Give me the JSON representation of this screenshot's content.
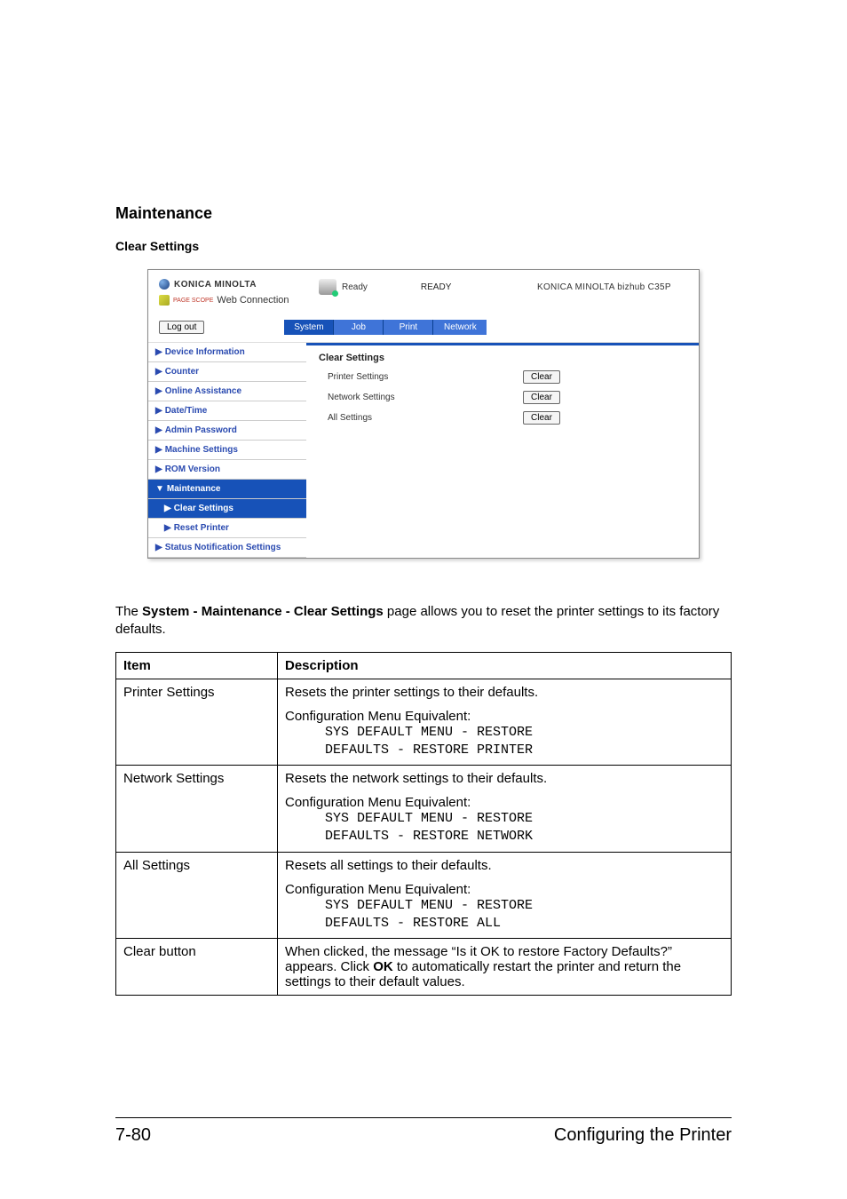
{
  "headings": {
    "main": "Maintenance",
    "sub": "Clear Settings"
  },
  "screenshot": {
    "brand": "KONICA MINOLTA",
    "connection": "Web Connection",
    "pagescope": "PAGE\nSCOPE",
    "status_label": "Ready",
    "ready_big": "READY",
    "model": "KONICA MINOLTA bizhub C35P",
    "logout": "Log out",
    "tabs": {
      "system": "System",
      "job": "Job",
      "print": "Print",
      "network": "Network"
    },
    "sidebar": {
      "device_info": "Device Information",
      "counter": "Counter",
      "online_assist": "Online Assistance",
      "date_time": "Date/Time",
      "admin_pw": "Admin Password",
      "machine": "Machine Settings",
      "rom": "ROM Version",
      "maintenance": "Maintenance",
      "clear_settings": "Clear Settings",
      "reset_printer": "Reset Printer",
      "status_notif": "Status Notification Settings"
    },
    "content": {
      "title": "Clear Settings",
      "rows": [
        {
          "label": "Printer Settings",
          "btn": "Clear"
        },
        {
          "label": "Network Settings",
          "btn": "Clear"
        },
        {
          "label": "All Settings",
          "btn": "Clear"
        }
      ]
    }
  },
  "paragraph": {
    "pre": "The ",
    "bold": "System - Maintenance - Clear Settings",
    "post": " page allows you to reset the printer settings to its factory defaults."
  },
  "table": {
    "head_item": "Item",
    "head_desc": "Description",
    "rows": [
      {
        "item": "Printer Settings",
        "desc": "Resets the printer settings to their defaults.",
        "cme": "Configuration Menu Equivalent:",
        "mono": "SYS DEFAULT MENU - RESTORE\nDEFAULTS - RESTORE PRINTER"
      },
      {
        "item": "Network Settings",
        "desc": "Resets the network settings to their defaults.",
        "cme": "Configuration Menu Equivalent:",
        "mono": "SYS DEFAULT MENU - RESTORE\nDEFAULTS - RESTORE NETWORK"
      },
      {
        "item": "All Settings",
        "desc": "Resets all settings to their defaults.",
        "cme": "Configuration Menu Equivalent:",
        "mono": "SYS DEFAULT MENU - RESTORE\nDEFAULTS - RESTORE ALL"
      },
      {
        "item": "Clear button",
        "desc_pre": "When clicked, the message “Is it OK to restore Factory Defaults?” appears. Click ",
        "desc_bold": "OK",
        "desc_post": " to automatically restart the printer and return the settings to their default values."
      }
    ]
  },
  "footer": {
    "page": "7-80",
    "section": "Configuring the Printer"
  }
}
